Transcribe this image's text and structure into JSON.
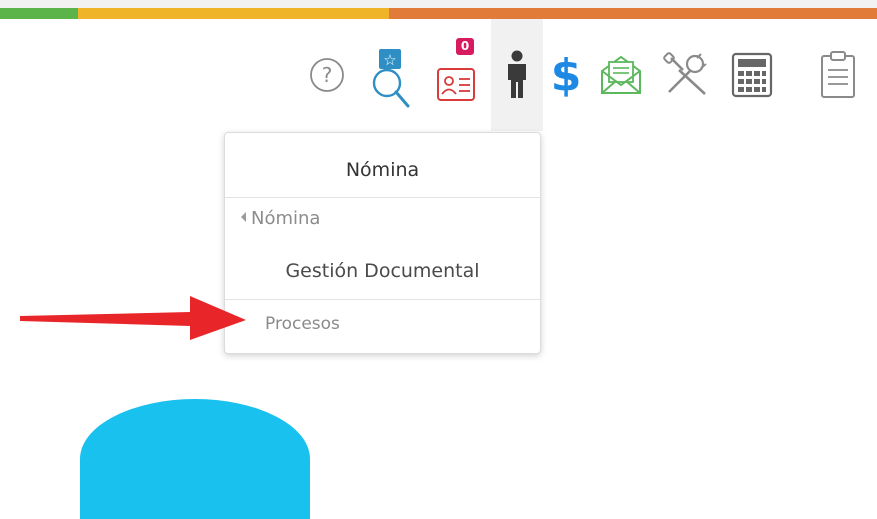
{
  "colors": {
    "bar_green": "#5bb449",
    "bar_yellow": "#f0b428",
    "bar_orange": "#e07b3a",
    "help_gray": "#8a8a8a",
    "search_blue": "#2f8fc4",
    "badge_blue": "#2f8fc4",
    "badge_pink": "#d81b60",
    "id_red": "#d93a3a",
    "person_dark": "#3a3a3a",
    "dollar_blue": "#1e88e5",
    "mail_green": "#5cb85c",
    "tools_gray": "#8a8a8a",
    "calc_gray": "#666666",
    "clipboard_gray": "#8a8a8a",
    "arrow_red": "#e8262a",
    "arc_cyan": "#19c1ef"
  },
  "toolbar": {
    "icons": [
      {
        "name": "help-icon"
      },
      {
        "name": "favorites-search-icon"
      },
      {
        "name": "id-card-icon",
        "badge": "0"
      },
      {
        "name": "person-icon",
        "active": true
      },
      {
        "name": "dollar-icon",
        "label": "$"
      },
      {
        "name": "mail-icon"
      },
      {
        "name": "tools-icon"
      },
      {
        "name": "calculator-icon"
      },
      {
        "name": "clipboard-icon"
      }
    ]
  },
  "dropdown": {
    "title": "Nómina",
    "back_label": "Nómina",
    "items": [
      "Gestión Documental",
      "Procesos"
    ]
  }
}
